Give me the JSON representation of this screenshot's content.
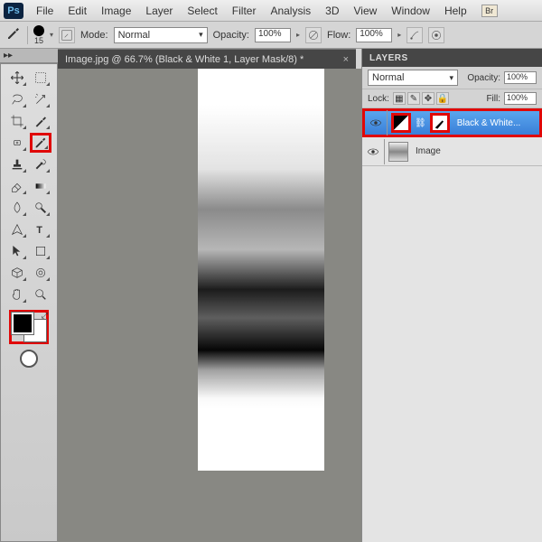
{
  "app": {
    "logo": "Ps"
  },
  "menu": [
    "File",
    "Edit",
    "Image",
    "Layer",
    "Select",
    "Filter",
    "Analysis",
    "3D",
    "View",
    "Window",
    "Help"
  ],
  "options": {
    "brush_size": "15",
    "mode_label": "Mode:",
    "mode_value": "Normal",
    "opacity_label": "Opacity:",
    "opacity_value": "100%",
    "flow_label": "Flow:",
    "flow_value": "100%"
  },
  "document": {
    "title": "Image.jpg @ 66.7% (Black & White 1, Layer Mask/8) *"
  },
  "panels": {
    "layers_title": "LAYERS",
    "blend_mode": "Normal",
    "opacity_label": "Opacity:",
    "opacity_value": "100%",
    "lock_label": "Lock:",
    "fill_label": "Fill:",
    "fill_value": "100%",
    "layers": [
      {
        "name": "Black & White..."
      },
      {
        "name": "Image"
      }
    ]
  },
  "colors": {
    "highlight": "#e00808",
    "selection": "#3a7fd8"
  }
}
